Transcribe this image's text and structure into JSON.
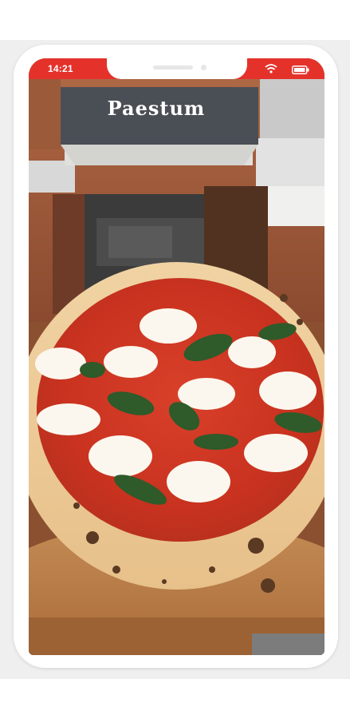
{
  "status_bar": {
    "time": "14:21",
    "wifi_icon": "wifi-icon",
    "battery_icon": "battery-icon",
    "accent_color": "#e4322b"
  },
  "hero_photo": {
    "sign_text": "Paestum"
  },
  "colors": {
    "status_bar": "#e4322b",
    "frame": "#ffffff",
    "backdrop": "#efefef"
  }
}
